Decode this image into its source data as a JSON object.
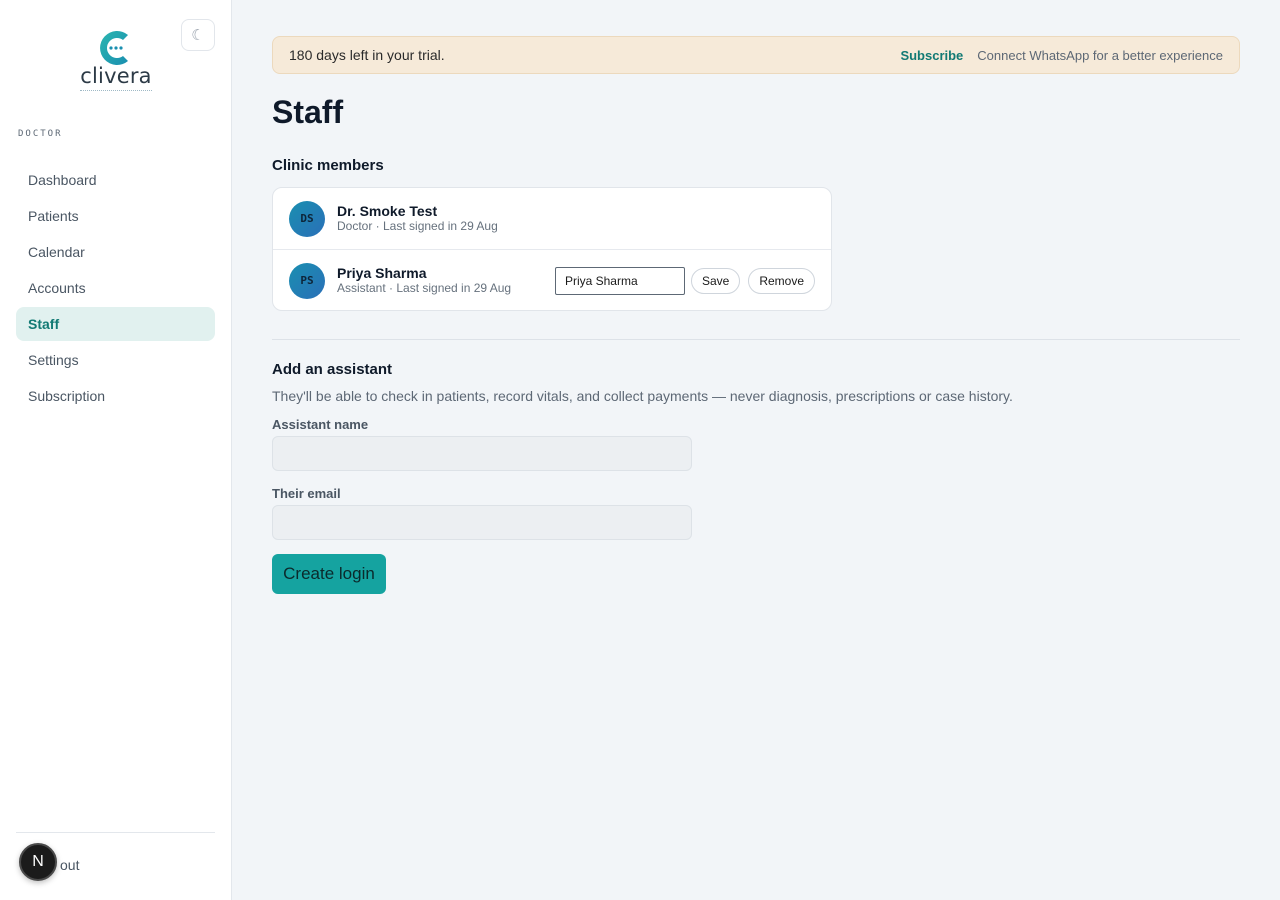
{
  "brand": {
    "name": "clivera",
    "tagline": "",
    "primary_color": "#15a3a0",
    "accent_color": "#127a74"
  },
  "theme_toggle": {
    "icon": "moon-icon",
    "glyph": "☾"
  },
  "sidebar": {
    "role_label": "DOCTOR",
    "items": [
      {
        "label": "Dashboard",
        "active": false
      },
      {
        "label": "Patients",
        "active": false
      },
      {
        "label": "Calendar",
        "active": false
      },
      {
        "label": "Accounts",
        "active": false
      },
      {
        "label": "Staff",
        "active": true
      },
      {
        "label": "Settings",
        "active": false
      },
      {
        "label": "Subscription",
        "active": false
      }
    ],
    "signout_label": "out",
    "badge_letter": "N"
  },
  "banner": {
    "text": "180 days left in your trial.",
    "subscribe_label": "Subscribe",
    "whatsapp_label": "Connect WhatsApp for a better experience"
  },
  "page": {
    "title": "Staff",
    "members_heading": "Clinic members",
    "members": [
      {
        "initials": "DS",
        "name": "Dr. Smoke Test",
        "meta": "Doctor · Last signed in 29 Aug",
        "editable": false
      },
      {
        "initials": "PS",
        "name": "Priya Sharma",
        "meta": "Assistant · Last signed in 29 Aug",
        "editable": true,
        "input_value": "Priya Sharma",
        "save_label": "Save",
        "remove_label": "Remove"
      }
    ],
    "add_heading": "Add an assistant",
    "add_help": "They'll be able to check in patients, record vitals, and collect payments — never diagnosis, prescriptions or case history.",
    "name_label": "Assistant name",
    "name_value": "",
    "email_label": "Their email",
    "email_value": "",
    "create_label": "Create login"
  }
}
